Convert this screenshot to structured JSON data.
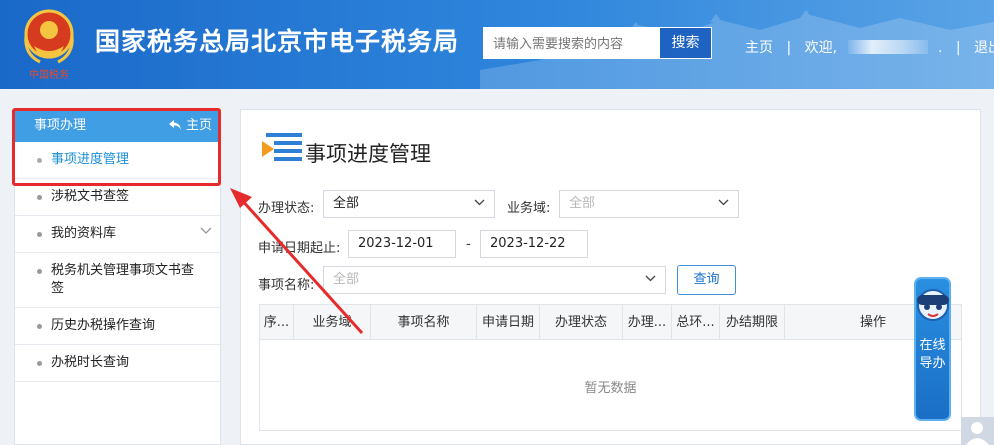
{
  "header": {
    "logo_text": "中国税务",
    "site_title": "国家税务总局北京市电子税务局",
    "search_placeholder": "请输入需要搜索的内容",
    "search_button": "搜索",
    "link_home": "主页",
    "sep1": "|",
    "welcome": "欢迎,",
    "dot": ".",
    "sep2": "|",
    "logout": "退出"
  },
  "sidebar": {
    "title": "事项办理",
    "home": "主页",
    "items": [
      {
        "label": "事项进度管理",
        "active": true
      },
      {
        "label": "涉税文书查签",
        "active": false
      },
      {
        "label": "我的资料库",
        "active": false,
        "expandable": true
      },
      {
        "label": "税务机关管理事项文书查签",
        "active": false
      },
      {
        "label": "历史办税操作查询",
        "active": false
      },
      {
        "label": "办税时长查询",
        "active": false
      }
    ]
  },
  "main": {
    "title": "事项进度管理",
    "filters": {
      "status_label": "办理状态:",
      "status_value": "全部",
      "domain_label": "业务域:",
      "domain_placeholder": "全部",
      "date_label": "申请日期起止:",
      "date_start": "2023-12-01",
      "date_sep": "-",
      "date_end": "2023-12-22",
      "item_label": "事项名称:",
      "item_placeholder": "全部",
      "query_button": "查询"
    },
    "table": {
      "columns": [
        "序...",
        "业务域",
        "事项名称",
        "申请日期",
        "办理状态",
        "办理...",
        "总环...",
        "办结期限",
        "操作"
      ],
      "empty_text": "暂无数据"
    }
  },
  "assistant": {
    "text": "在线导办"
  },
  "colors": {
    "header_blue": "#1a69c9",
    "sidebar_head": "#3f9ee4",
    "active_link": "#1b8fd6",
    "annotation_red": "#e52b2b"
  }
}
